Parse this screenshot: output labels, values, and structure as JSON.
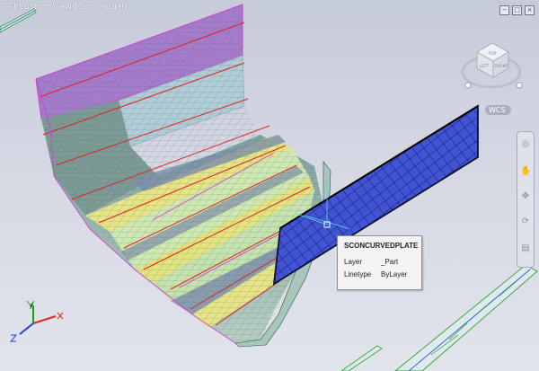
{
  "viewport": {
    "label": "[−][Custom View][Conceptual]",
    "controls": [
      "−",
      "□",
      "×"
    ],
    "background": "#d0d4df"
  },
  "viewcube": {
    "faces": {
      "top": "TOP",
      "left": "LEFT",
      "front": "FRONT"
    },
    "compass_label": "WCS"
  },
  "navigation_bar": {
    "icons": [
      "steering-wheel-icon",
      "pan-icon",
      "zoom-icon",
      "orbit-icon",
      "showmotion-icon"
    ]
  },
  "tooltip": {
    "title": "SCONCURVEDPLATE",
    "rows": [
      {
        "key": "Layer",
        "value": "_Part"
      },
      {
        "key": "Linetype",
        "value": "ByLayer"
      }
    ]
  },
  "colors": {
    "purple_panel": "#a77ccc",
    "teal_panel": "#8aa9a4",
    "yellow_strip": "#e6e484",
    "green_strip": "#cfe8b0",
    "blue_plate": "#3d4fd0",
    "seam_red": "#e02020",
    "magenta_edge": "#d040d0"
  },
  "ucs": {
    "x": "X",
    "y": "Y",
    "z": "Z"
  }
}
